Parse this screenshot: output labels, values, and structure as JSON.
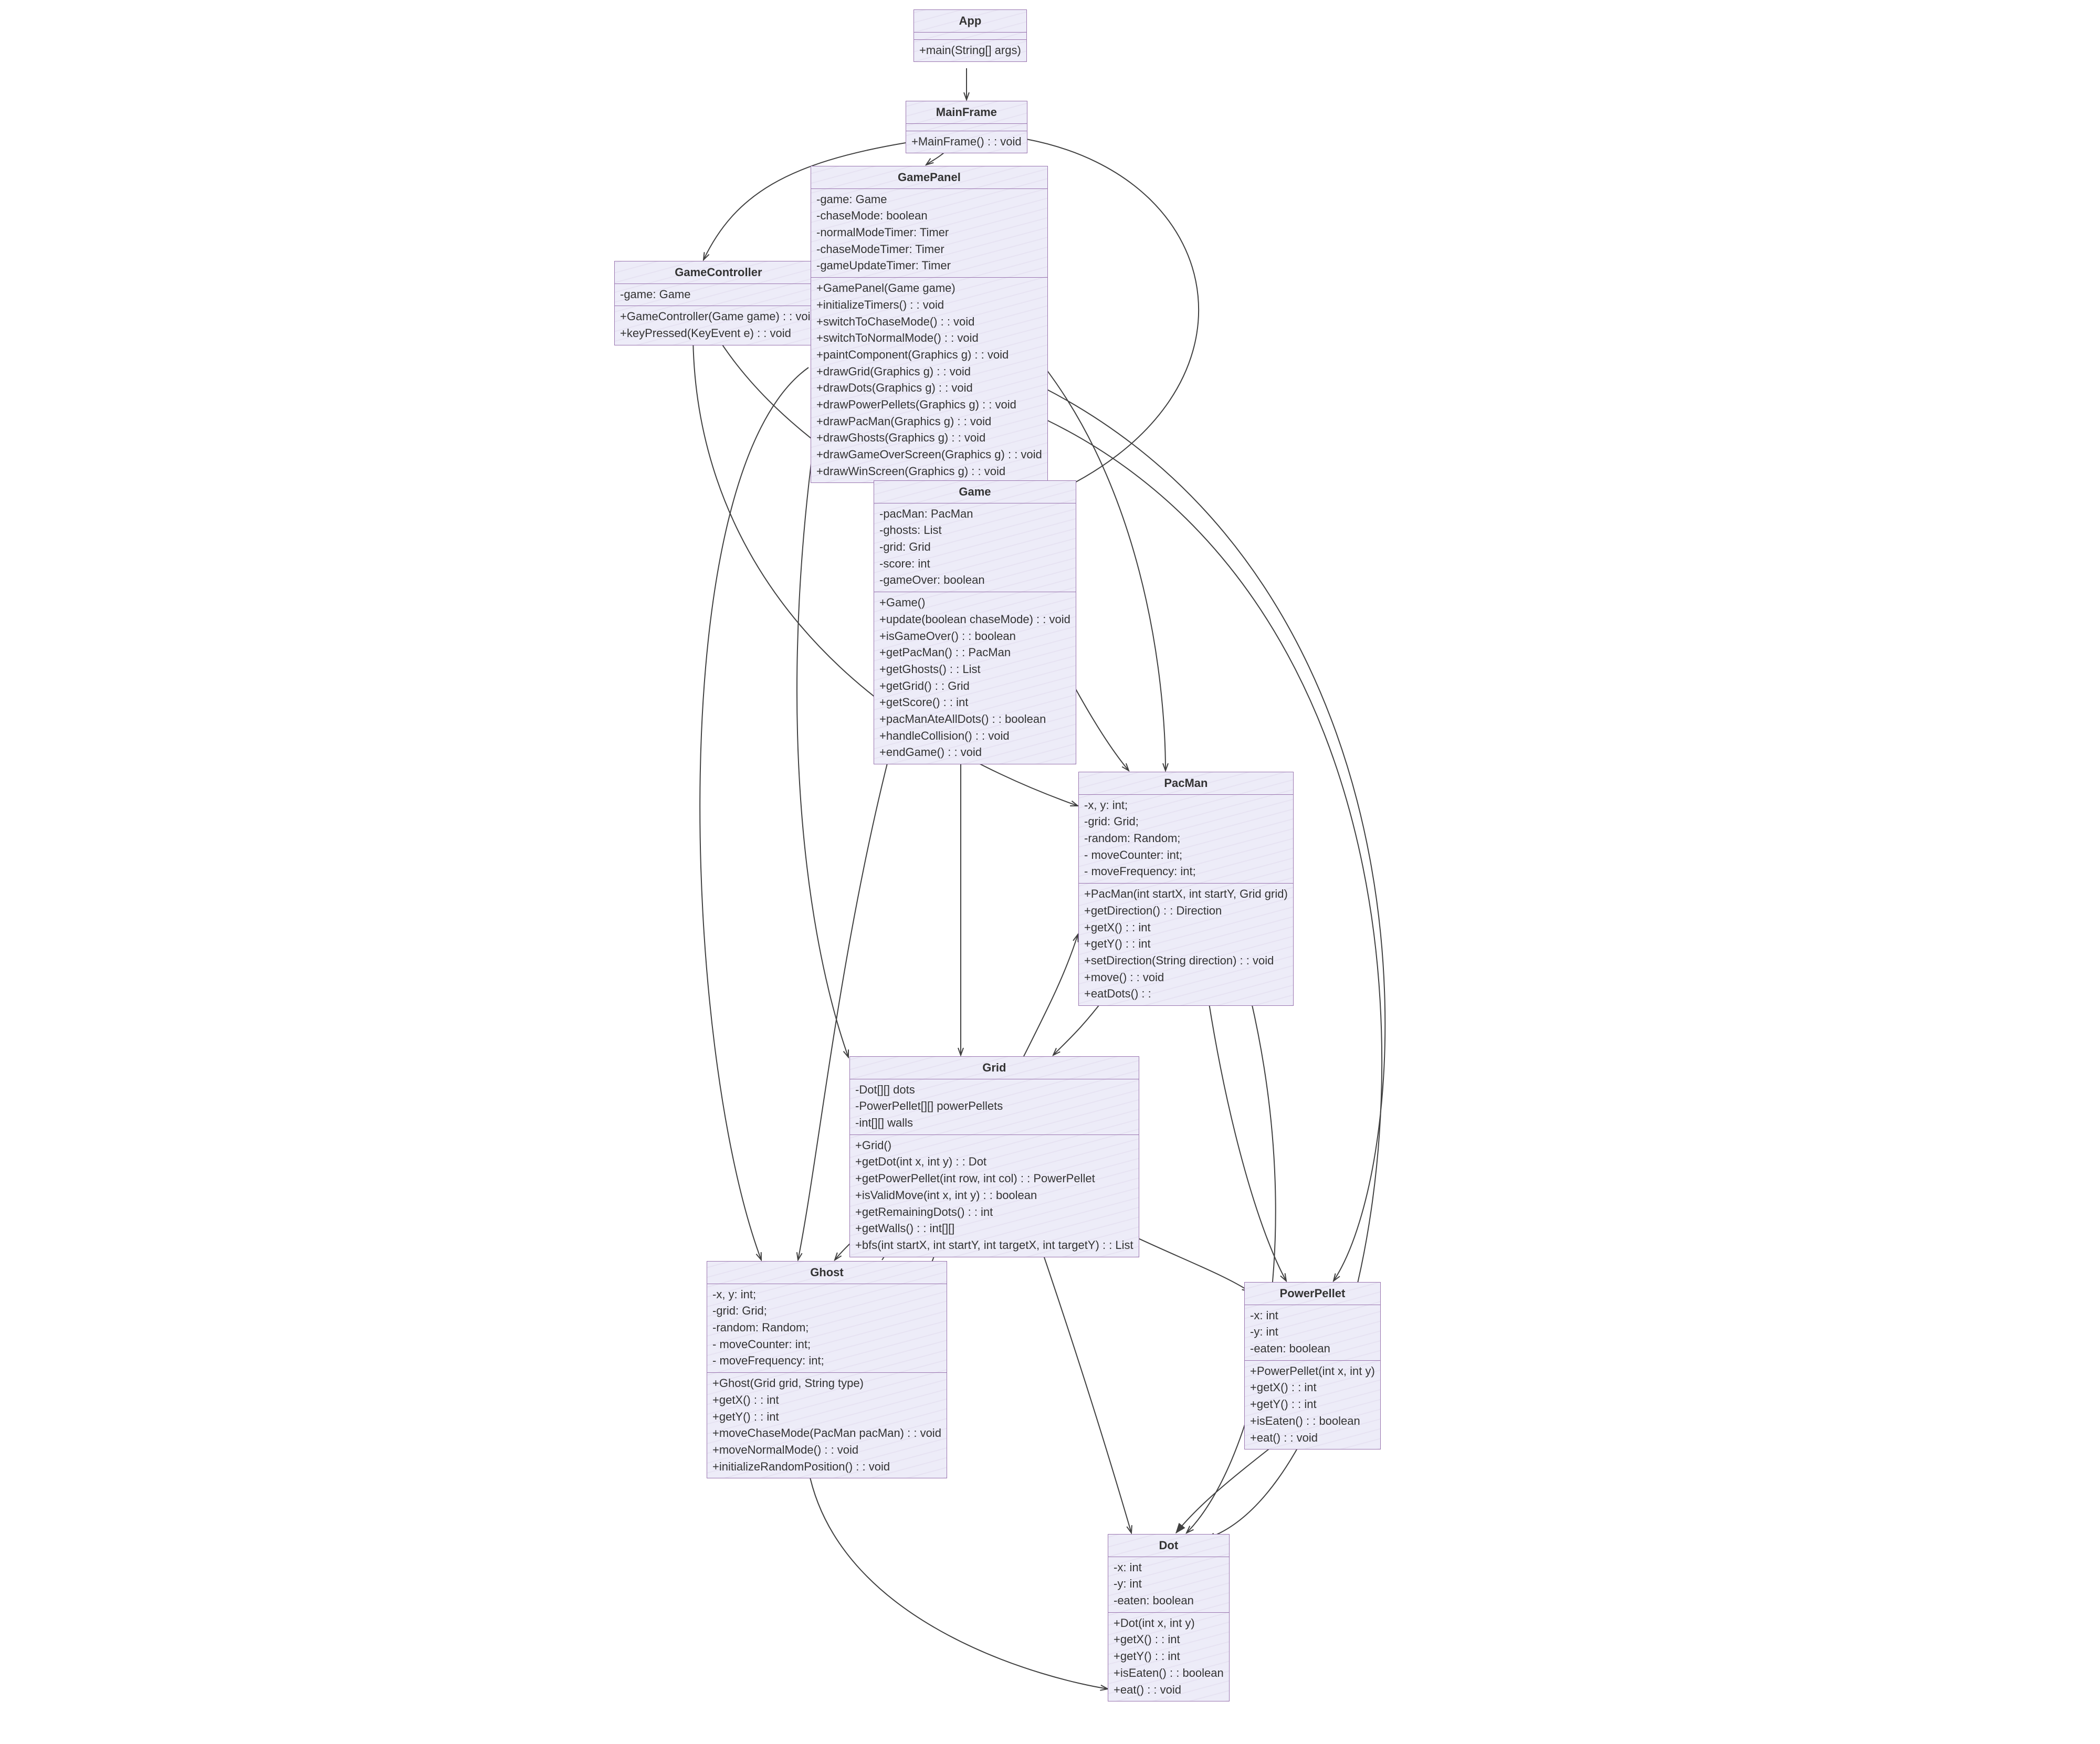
{
  "classes": {
    "App": {
      "title": "App",
      "fields": [],
      "methods": [
        "+main(String[] args)"
      ]
    },
    "MainFrame": {
      "title": "MainFrame",
      "fields": [],
      "methods": [
        "+MainFrame() : : void"
      ]
    },
    "GameController": {
      "title": "GameController",
      "fields": [
        "-game: Game"
      ],
      "methods": [
        "+GameController(Game game) : : void",
        "+keyPressed(KeyEvent e) : : void"
      ]
    },
    "GamePanel": {
      "title": "GamePanel",
      "fields": [
        "-game: Game",
        "-chaseMode: boolean",
        "-normalModeTimer: Timer",
        "-chaseModeTimer: Timer",
        "-gameUpdateTimer: Timer"
      ],
      "methods": [
        "+GamePanel(Game game)",
        "+initializeTimers() : : void",
        "+switchToChaseMode() : : void",
        "+switchToNormalMode() : : void",
        "+paintComponent(Graphics g) : : void",
        "+drawGrid(Graphics g) : : void",
        "+drawDots(Graphics g) : : void",
        "+drawPowerPellets(Graphics g) : : void",
        "+drawPacMan(Graphics g) : : void",
        "+drawGhosts(Graphics g) : : void",
        "+drawGameOverScreen(Graphics g) : : void",
        "+drawWinScreen(Graphics g) : : void"
      ]
    },
    "Game": {
      "title": "Game",
      "fields": [
        "-pacMan: PacMan",
        "-ghosts: List",
        "-grid: Grid",
        "-score: int",
        "-gameOver: boolean"
      ],
      "methods": [
        "+Game()",
        "+update(boolean chaseMode) : : void",
        "+isGameOver() : : boolean",
        "+getPacMan() : : PacMan",
        "+getGhosts() : : List",
        "+getGrid() : : Grid",
        "+getScore() : : int",
        "+pacManAteAllDots() : : boolean",
        "+handleCollision() : : void",
        "+endGame() : : void"
      ]
    },
    "PacMan": {
      "title": "PacMan",
      "fields": [
        "-x, y: int;",
        "-grid: Grid;",
        "-random: Random;",
        "- moveCounter: int;",
        "- moveFrequency: int;"
      ],
      "methods": [
        "+PacMan(int startX, int startY, Grid grid)",
        "+getDirection() : : Direction",
        "+getX() : : int",
        "+getY() : : int",
        "+setDirection(String direction) : : void",
        "+move() : : void",
        "+eatDots() : :"
      ]
    },
    "Grid": {
      "title": "Grid",
      "fields": [
        "-Dot[][] dots",
        "-PowerPellet[][] powerPellets",
        "-int[][] walls"
      ],
      "methods": [
        "+Grid()",
        "+getDot(int x, int y) : : Dot",
        "+getPowerPellet(int row, int col) : : PowerPellet",
        "+isValidMove(int x, int y) : : boolean",
        "+getRemainingDots() : : int",
        "+getWalls() : : int[][]",
        "+bfs(int startX, int startY, int targetX, int targetY) : : List"
      ]
    },
    "Ghost": {
      "title": "Ghost",
      "fields": [
        "-x, y: int;",
        "-grid: Grid;",
        "-random: Random;",
        "- moveCounter: int;",
        "- moveFrequency: int;"
      ],
      "methods": [
        "+Ghost(Grid grid, String type)",
        "+getX() : : int",
        "+getY() : : int",
        "+moveChaseMode(PacMan pacMan) : : void",
        "+moveNormalMode() : : void",
        "+initializeRandomPosition() : : void"
      ]
    },
    "PowerPellet": {
      "title": "PowerPellet",
      "fields": [
        "-x: int",
        "-y: int",
        "-eaten: boolean"
      ],
      "methods": [
        "+PowerPellet(int x, int y)",
        "+getX() : : int",
        "+getY() : : int",
        "+isEaten() : : boolean",
        "+eat() : : void"
      ]
    },
    "Dot": {
      "title": "Dot",
      "fields": [
        "-x: int",
        "-y: int",
        "-eaten: boolean"
      ],
      "methods": [
        "+Dot(int x, int y)",
        "+getX() : : int",
        "+getY() : : int",
        "+isEaten() : : boolean",
        "+eat() : : void"
      ]
    }
  },
  "colors": {
    "line": "#404040",
    "box_border": "#9974af",
    "box_fill": "#edecf8"
  }
}
